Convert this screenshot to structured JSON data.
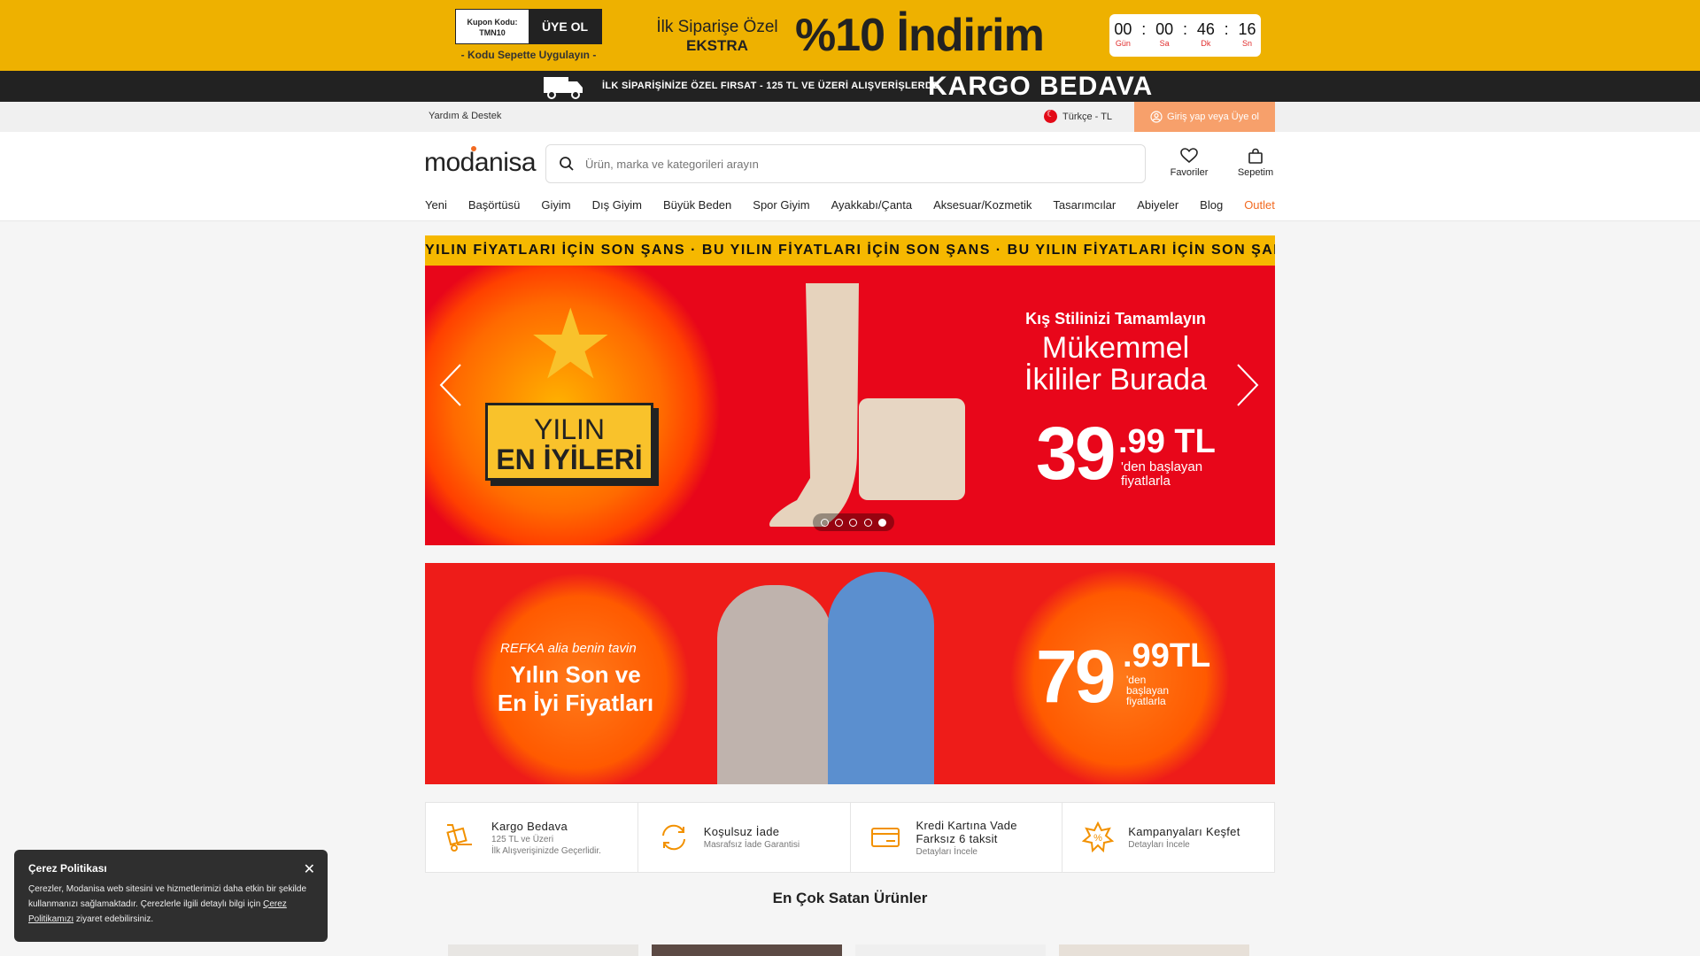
{
  "promo": {
    "coupon_label": "Kupon Kodu:",
    "coupon_code": "TMN10",
    "coupon_button": "ÜYE OL",
    "coupon_note": "- Kodu Sepette Uygulayın -",
    "small_line1": "İlk Siparişe Özel",
    "small_line2": "EKSTRA",
    "big_text": "%10 İndirim",
    "countdown": [
      {
        "value": "00",
        "label": "Gün"
      },
      {
        "value": "00",
        "label": "Sa"
      },
      {
        "value": "46",
        "label": "Dk"
      },
      {
        "value": "16",
        "label": "Sn"
      }
    ]
  },
  "shipbar": {
    "small_text": "İLK SİPARİŞİNİZE ÖZEL FIRSAT - 125 TL VE ÜZERİ ALIŞVERİŞLERDE",
    "big_text": "KARGO BEDAVA"
  },
  "topbar": {
    "help": "Yardım & Destek",
    "language": "Türkçe - TL",
    "login": "Giriş yap veya Üye ol"
  },
  "header": {
    "logo": "modanisa",
    "search_placeholder": "Ürün, marka ve kategorileri arayın",
    "favorites": "Favoriler",
    "cart": "Sepetim"
  },
  "nav": [
    "Yeni",
    "Başörtüsü",
    "Giyim",
    "Dış Giyim",
    "Büyük Beden",
    "Spor Giyim",
    "Ayakkabı/Çanta",
    "Aksesuar/Kozmetik",
    "Tasarımcılar",
    "Abiyeler",
    "Blog",
    "Outlet"
  ],
  "marquee": "YILIN FİYATLARI İÇİN SON ŞANS · BU YILIN FİYATLARI İÇİN SON ŞANS · BU YILIN FİYATLARI İÇİN SON ŞANS",
  "hero": {
    "badge_line1": "YILIN",
    "badge_line2": "EN İYİLERİ",
    "subtitle": "Kış Stilinizi Tamamlayın",
    "title_line1": "Mükemmel",
    "title_line2": "İkililer Burada",
    "price_main": "39",
    "price_sub": ".99 TL",
    "price_note_1": "'den başlayan",
    "price_note_2": "fiyatlarla",
    "slide_count": 5,
    "active_slide": 5
  },
  "banner2": {
    "brands": "REFKA  alia  benin  tavin",
    "title_line1": "Yılın Son ve",
    "title_line2": "En İyi Fiyatları",
    "price_main": "79",
    "price_sub": ".99TL",
    "note_1": "'den",
    "note_2": "başlayan",
    "note_3": "fiyatlarla"
  },
  "features": [
    {
      "icon": "truck-icon",
      "title": "Kargo Bedava",
      "desc1": "125 TL ve Üzeri",
      "desc2": "İlk Alışverişinizde Geçerlidir."
    },
    {
      "icon": "refresh-icon",
      "title": "Koşulsuz İade",
      "desc1": "Masrafsız İade Garantisi",
      "desc2": ""
    },
    {
      "icon": "credit-card-icon",
      "title": "Kredi Kartına Vade",
      "title2": "Farksız 6 taksit",
      "desc1": "Detayları İncele",
      "desc2": ""
    },
    {
      "icon": "percent-badge-icon",
      "title": "Kampanyaları Keşfet",
      "desc1": "Detayları İncele",
      "desc2": ""
    }
  ],
  "section_title": "En Çok Satan Ürünler",
  "cookie": {
    "title": "Çerez Politikası",
    "body_1": "Çerezler, Modanisa web sitesini ve hizmetlerimizi daha etkin bir şekilde kullanmanızı sağlamaktadır. Çerezlerle ilgili detaylı bilgi için ",
    "link": "Çerez Politikamızı",
    "body_2": " ziyaret edebilirsiniz."
  },
  "colors": {
    "promo_yellow": "#eeb100",
    "brand_orange": "#f26a21",
    "hero_red": "#e8061a",
    "dark": "#222222"
  }
}
